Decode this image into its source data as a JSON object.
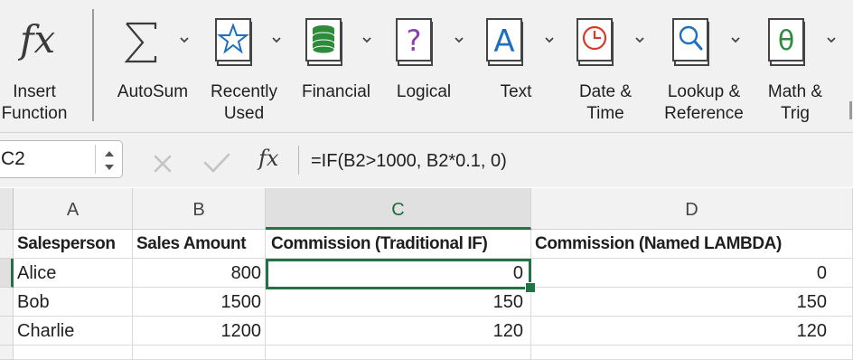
{
  "ribbon": {
    "items": [
      {
        "id": "insert-function",
        "label_lines": [
          "Insert",
          "Function"
        ],
        "icon": "fx-icon"
      },
      {
        "id": "autosum",
        "label_lines": [
          "AutoSum"
        ],
        "icon": "sigma-icon"
      },
      {
        "id": "recently-used",
        "label_lines": [
          "Recently",
          "Used"
        ],
        "icon": "star-book-icon"
      },
      {
        "id": "financial",
        "label_lines": [
          "Financial"
        ],
        "icon": "coins-book-icon"
      },
      {
        "id": "logical",
        "label_lines": [
          "Logical"
        ],
        "icon": "question-book-icon"
      },
      {
        "id": "text",
        "label_lines": [
          "Text"
        ],
        "icon": "letter-a-book-icon"
      },
      {
        "id": "date-time",
        "label_lines": [
          "Date &",
          "Time"
        ],
        "icon": "clock-book-icon"
      },
      {
        "id": "lookup-reference",
        "label_lines": [
          "Lookup &",
          "Reference"
        ],
        "icon": "magnifier-book-icon"
      },
      {
        "id": "math-trig",
        "label_lines": [
          "Math &",
          "Trig"
        ],
        "icon": "theta-book-icon"
      }
    ],
    "insert_function": {
      "line1": "Insert",
      "line2": "Function"
    },
    "autosum": {
      "line1": "AutoSum"
    },
    "recently_used": {
      "line1": "Recently",
      "line2": "Used"
    },
    "financial": {
      "line1": "Financial"
    },
    "logical": {
      "line1": "Logical"
    },
    "text": {
      "line1": "Text"
    },
    "date_time": {
      "line1": "Date &",
      "line2": "Time"
    },
    "lookup_reference": {
      "line1": "Lookup &",
      "line2": "Reference"
    },
    "math_trig": {
      "line1": "Math &",
      "line2": "Trig"
    },
    "colors": {
      "book": "#ffffff",
      "book_edge": "#444444",
      "star": "#1f6fc0",
      "coins": "#2e8b3c",
      "question": "#8a3fb0",
      "letter_a": "#1f6fc0",
      "clock": "#d93a2b",
      "magnifier": "#1f6fc0",
      "theta": "#2e8b3c"
    }
  },
  "formula_bar": {
    "name_box": "C2",
    "fx_label": "fx",
    "formula": "=IF(B2>1000, B2*0.1, 0)"
  },
  "sheet": {
    "columns": [
      "A",
      "B",
      "C",
      "D"
    ],
    "selected_column": "C",
    "selected_cell": "C2",
    "accent": "#217346",
    "headers": [
      "Salesperson",
      "Sales Amount",
      "Commission (Traditional IF)",
      "Commission (Named LAMBDA)"
    ],
    "rows": [
      [
        "Alice",
        "800",
        "0",
        "0"
      ],
      [
        "Bob",
        "1500",
        "150",
        "150"
      ],
      [
        "Charlie",
        "1200",
        "120",
        "120"
      ]
    ]
  }
}
